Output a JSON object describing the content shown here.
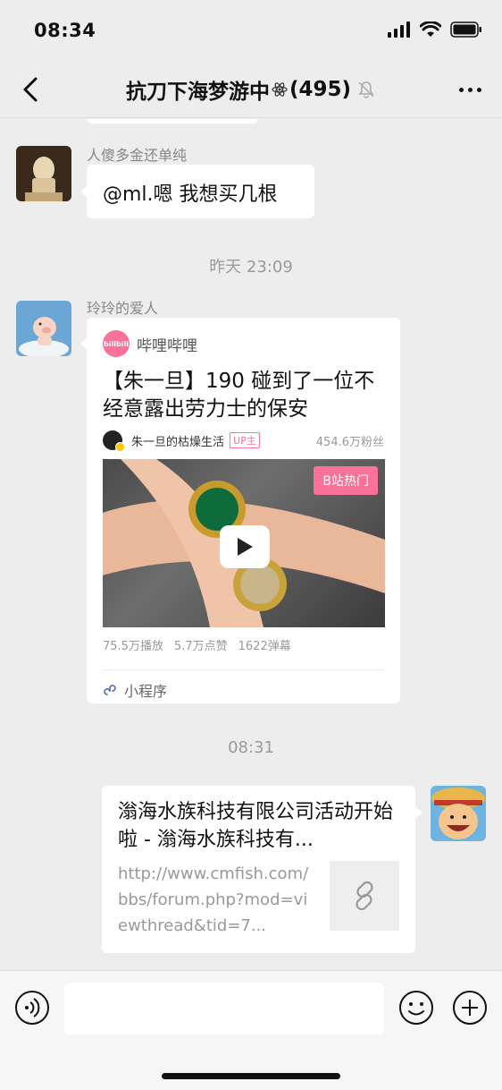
{
  "status": {
    "time": "08:34"
  },
  "nav": {
    "title": "抗刀下海梦游中",
    "member_count": "(495)"
  },
  "messages": [
    {
      "sender": "人傻多金还单纯",
      "text": "@ml.嗯 我想买几根"
    },
    {
      "timestamp": "昨天 23:09"
    },
    {
      "sender": "玲玲的爱人",
      "mini_program": {
        "source": "哔哩哔哩",
        "logo_text": "bilibili",
        "title": "【朱一旦】190 碰到了一位不经意露出劳力士的保安",
        "up_name": "朱一旦的枯燥生活",
        "up_badge": "UP主",
        "fans": "454.6万粉丝",
        "hot_tag": "B站热门",
        "plays": "75.5万播放",
        "likes": "5.7万点赞",
        "danmaku": "1622弹幕",
        "footer": "小程序"
      }
    },
    {
      "timestamp": "08:31"
    },
    {
      "self": true,
      "link": {
        "title": "滃海水族科技有限公司活动开始啦 - 滃海水族科技有...",
        "url": "http://www.cmfish.com/bbs/forum.php?mod=viewthread&tid=7..."
      }
    }
  ],
  "input": {
    "placeholder": ""
  },
  "colors": {
    "bilibili_pink": "#fb7299",
    "background": "#ededed"
  }
}
